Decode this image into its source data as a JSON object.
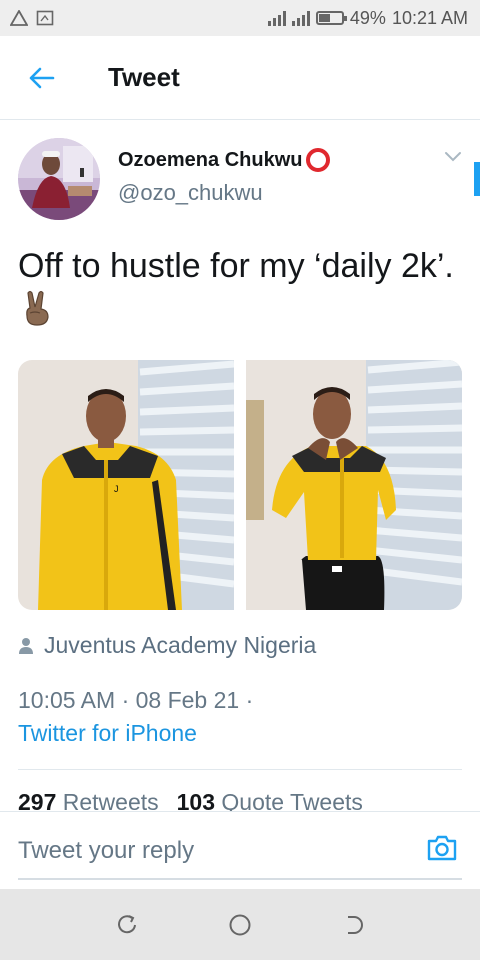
{
  "status_bar": {
    "battery": "49%",
    "time": "10:21 AM",
    "battery_level": 0.49
  },
  "header": {
    "title": "Tweet"
  },
  "tweet": {
    "display_name": "Ozoemena Chukwu",
    "handle": "@ozo_chukwu",
    "text": "Off to hustle for my ‘daily 2k’.",
    "location": "Juventus Academy Nigeria",
    "time": "10:05 AM · 08 Feb 21 ·",
    "source": "Twitter for iPhone",
    "retweets_count": "297",
    "retweets_label": "Retweets",
    "quotes_count": "103",
    "quotes_label": "Quote Tweets"
  },
  "reply": {
    "placeholder": "Tweet your reply"
  },
  "colors": {
    "accent": "#1da1f2",
    "link": "#1b95e0",
    "jersey": "#f2c318",
    "name_emoji": "#e0282e"
  },
  "icons": {
    "back": "arrow-left-icon",
    "chevron": "chevron-down-icon",
    "location": "person-pin-icon",
    "camera": "camera-icon"
  }
}
